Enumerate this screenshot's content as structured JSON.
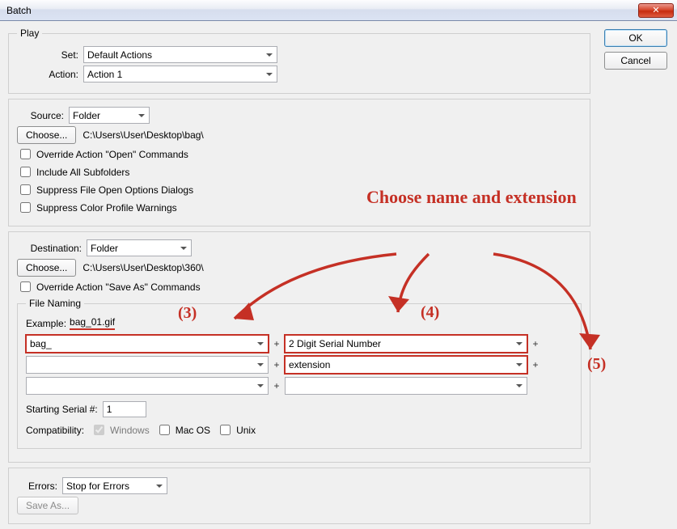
{
  "window": {
    "title": "Batch",
    "close_icon": "✕"
  },
  "buttons": {
    "ok": "OK",
    "cancel": "Cancel",
    "choose": "Choose...",
    "save_as": "Save As..."
  },
  "play": {
    "legend": "Play",
    "set_label": "Set:",
    "set_value": "Default Actions",
    "action_label": "Action:",
    "action_value": "Action 1"
  },
  "source": {
    "label": "Source:",
    "value": "Folder",
    "path": "C:\\Users\\User\\Desktop\\bag\\",
    "override_open": "Override Action \"Open\" Commands",
    "include_subfolders": "Include All Subfolders",
    "suppress_file_open": "Suppress File Open Options Dialogs",
    "suppress_color": "Suppress Color Profile Warnings"
  },
  "destination": {
    "label": "Destination:",
    "value": "Folder",
    "path": "C:\\Users\\User\\Desktop\\360\\",
    "override_save": "Override Action \"Save As\" Commands"
  },
  "file_naming": {
    "legend": "File Naming",
    "example_label": "Example:",
    "example_value": "bag_01.gif",
    "fields": {
      "f1": "bag_",
      "f2": "2 Digit Serial Number",
      "f3": "",
      "f4": "extension",
      "f5": "",
      "f6": ""
    },
    "starting_serial_label": "Starting Serial #:",
    "starting_serial_value": "1",
    "compat_label": "Compatibility:",
    "compat_windows": "Windows",
    "compat_mac": "Mac OS",
    "compat_unix": "Unix"
  },
  "errors": {
    "label": "Errors:",
    "value": "Stop for Errors"
  },
  "annotations": {
    "main_text": "Choose name and extension",
    "n3": "(3)",
    "n4": "(4)",
    "n5": "(5)"
  }
}
